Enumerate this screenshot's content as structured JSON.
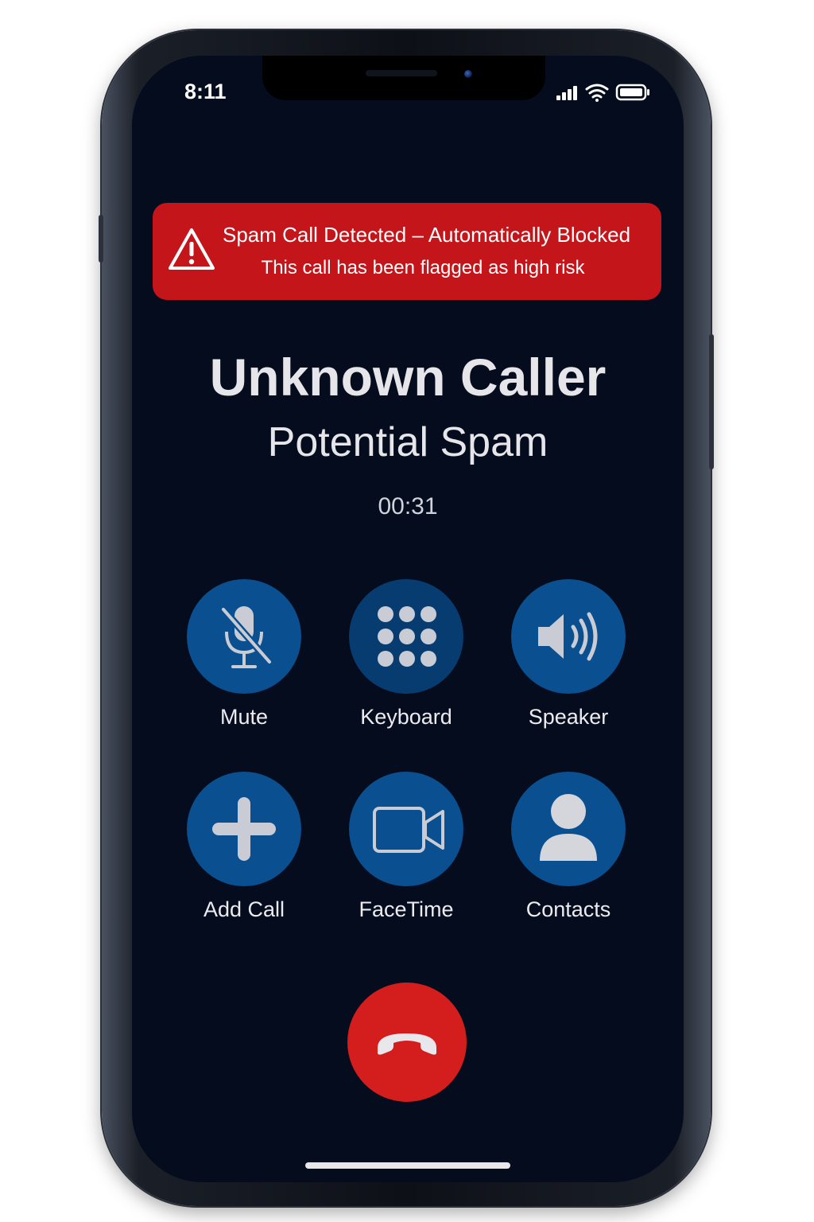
{
  "status_bar": {
    "time": "8:11",
    "icons": [
      "signal-icon",
      "wifi-icon",
      "battery-icon"
    ]
  },
  "alert": {
    "icon": "warning-triangle-icon",
    "title": "Spam Call Detected – Automatically Blocked",
    "subtitle": "This call has been flagged as high risk",
    "color": "#c4151b"
  },
  "caller": {
    "name": "Unknown Caller",
    "tag": "Potential Spam",
    "duration": "00:31"
  },
  "controls": [
    {
      "label": "Mute",
      "icon": "mic-off-icon"
    },
    {
      "label": "Keyboard",
      "icon": "keypad-icon"
    },
    {
      "label": "Speaker",
      "icon": "speaker-icon"
    },
    {
      "label": "Add Call",
      "icon": "plus-icon"
    },
    {
      "label": "FaceTime",
      "icon": "video-camera-icon"
    },
    {
      "label": "Contacts",
      "icon": "person-icon"
    }
  ],
  "end_call": {
    "icon": "hang-up-icon",
    "color": "#d41d1d"
  },
  "colors": {
    "screen_background": "#040c1d",
    "control_button": "#0a4f8f"
  }
}
